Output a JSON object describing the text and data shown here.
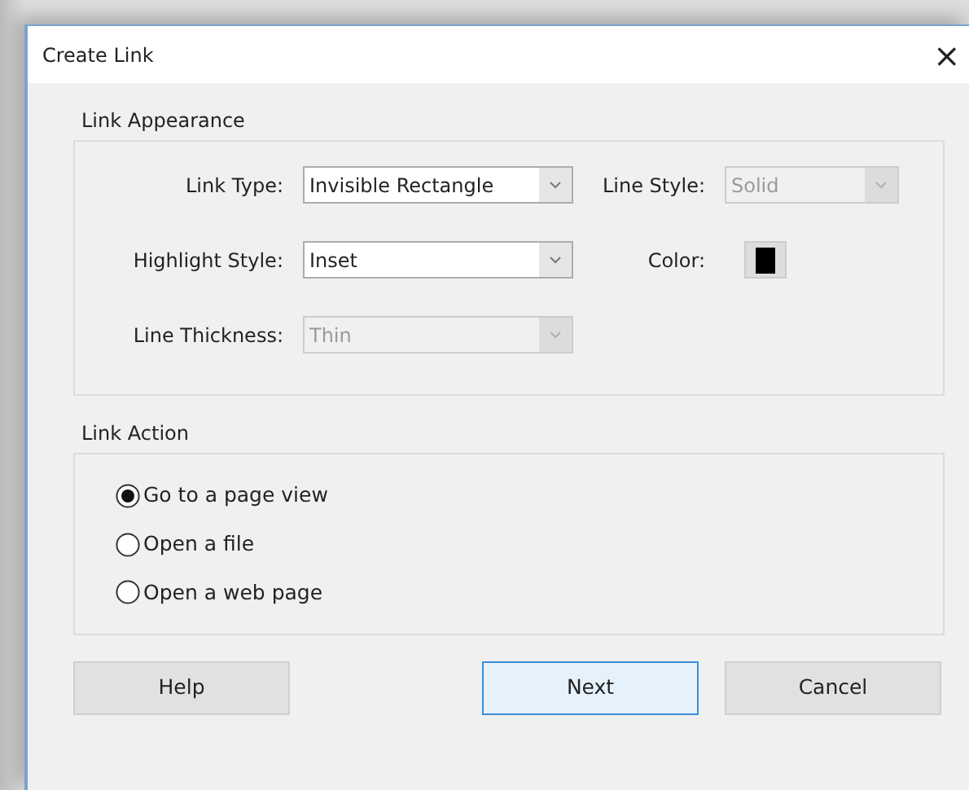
{
  "window": {
    "title": "Create Link",
    "close": "×"
  },
  "appearance": {
    "title": "Link Appearance",
    "fields": [
      {
        "label": "Link Type:",
        "value": "Invisible Rectangle",
        "disabled": false
      },
      {
        "label": "Line Style:",
        "value": "Solid",
        "disabled": true
      },
      {
        "label": "Highlight Style:",
        "value": "Inset",
        "disabled": false
      },
      {
        "label": "Color:",
        "kind": "color",
        "color": "#000000"
      },
      {
        "label": "Line Thickness:",
        "value": "Thin",
        "disabled": true
      }
    ]
  },
  "action": {
    "title": "Link Action",
    "options": [
      {
        "label": "Go to a page view",
        "selected": true
      },
      {
        "label": "Open a file",
        "selected": false
      },
      {
        "label": "Open a web page",
        "selected": false
      }
    ]
  },
  "buttons": [
    {
      "label": "Help",
      "default": false
    },
    {
      "label": "Next",
      "default": true
    },
    {
      "label": "Cancel",
      "default": false
    }
  ]
}
